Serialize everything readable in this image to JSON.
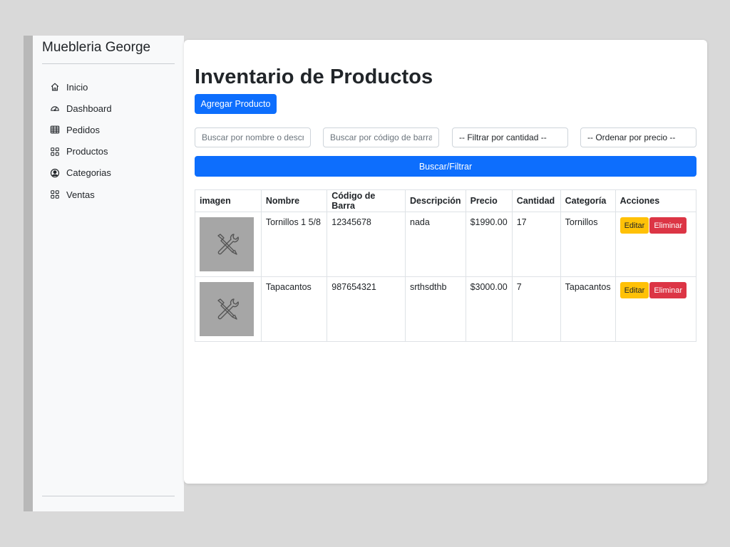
{
  "sidebar": {
    "brand": "Muebleria George",
    "items": [
      {
        "label": "Inicio",
        "icon": "home-icon"
      },
      {
        "label": "Dashboard",
        "icon": "speedometer-icon"
      },
      {
        "label": "Pedidos",
        "icon": "table-icon"
      },
      {
        "label": "Productos",
        "icon": "grid-icon"
      },
      {
        "label": "Categorias",
        "icon": "person-circle-icon"
      },
      {
        "label": "Ventas",
        "icon": "grid-icon"
      }
    ]
  },
  "main": {
    "title": "Inventario de Productos",
    "add_button": "Agregar Producto",
    "filters": {
      "name_placeholder": "Buscar por nombre o descripción",
      "barcode_placeholder": "Buscar por código de barra",
      "quantity_select": "-- Filtrar por cantidad --",
      "price_select": "-- Ordenar por precio --"
    },
    "search_button": "Buscar/Filtrar",
    "table": {
      "headers": [
        "imagen",
        "Nombre",
        "Código de Barra",
        "Descripción",
        "Precio",
        "Cantidad",
        "Categoría",
        "Acciones"
      ],
      "rows": [
        {
          "nombre": "Tornillos 1 5/8",
          "codigo": "12345678",
          "descripcion": "nada",
          "precio": "$1990.00",
          "cantidad": "17",
          "categoria": "Tornillos"
        },
        {
          "nombre": "Tapacantos",
          "codigo": "987654321",
          "descripcion": "srthsdthb",
          "precio": "$3000.00",
          "cantidad": "7",
          "categoria": "Tapacantos"
        }
      ],
      "edit_label": "Editar",
      "delete_label": "Eliminar"
    }
  },
  "colors": {
    "primary": "#0d6efd",
    "warning": "#ffc107",
    "danger": "#dc3545",
    "sidebar_bg": "#f8f9fa",
    "placeholder_image": "#a6a6a6"
  }
}
